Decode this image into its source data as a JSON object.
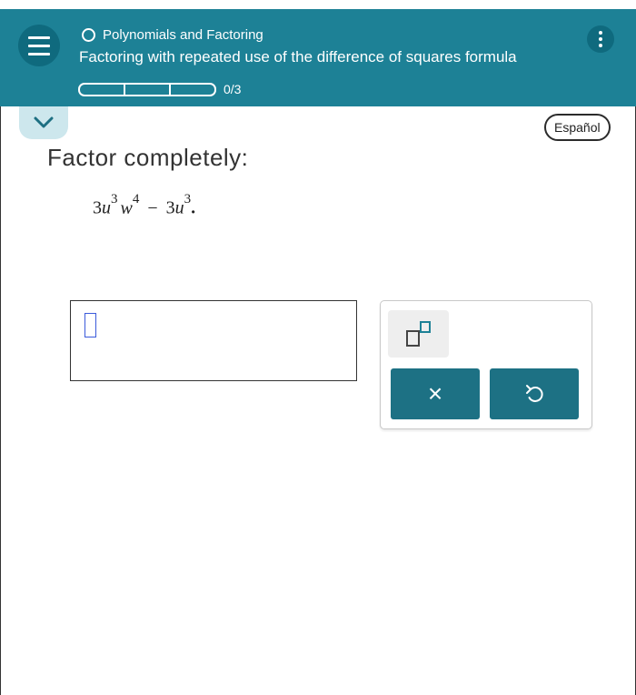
{
  "header": {
    "topic": "Polynomials and Factoring",
    "title": "Factoring with repeated use of the difference of squares formula",
    "progress_text": "0/3",
    "progress_segments": 3,
    "progress_completed": 0,
    "menu_icon": "hamburger-menu-icon",
    "more_icon": "kebab-menu-icon",
    "accent_color": "#1d8196"
  },
  "language_button": "Español",
  "problem": {
    "prompt": "Factor completely:",
    "expression": {
      "t1_coef": "3",
      "t1_var1": "u",
      "t1_exp1": "3",
      "t1_var2": "w",
      "t1_exp2": "4",
      "operator": "−",
      "t2_coef": "3",
      "t2_var": "u",
      "t2_exp": "3",
      "end": "."
    }
  },
  "keypad": {
    "exponent_icon": "exponent-template-icon",
    "clear_label": "×",
    "undo_icon": "undo-icon"
  }
}
